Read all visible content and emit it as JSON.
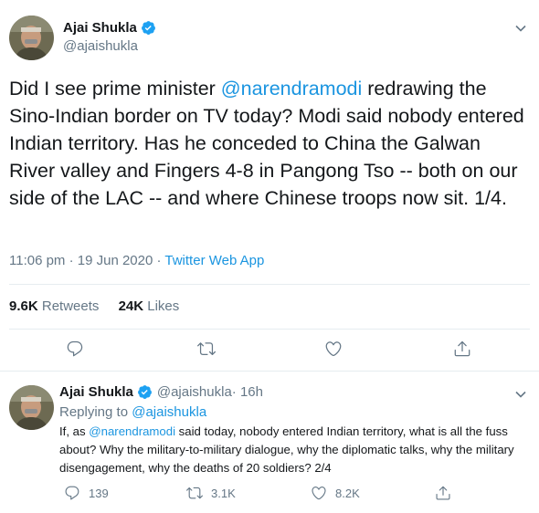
{
  "main_tweet": {
    "author_name": "Ajai Shukla",
    "author_handle": "@ajaishukla",
    "text_part1": "Did I see prime minister ",
    "mention": "@narendramodi",
    "text_part2": " redrawing the Sino-Indian border on TV today? Modi said nobody entered Indian territory. Has he conceded to China the Galwan River valley and Fingers 4-8 in Pangong Tso -- both on our side of the LAC -- and where Chinese troops now sit. 1/4.",
    "time": "11:06 pm · 19 Jun 2020 · ",
    "source": "Twitter Web App",
    "retweets_count": "9.6K",
    "retweets_label": " Retweets",
    "likes_count": "24K",
    "likes_label": " Likes",
    "actions": [
      "reply-icon",
      "retweet-icon",
      "like-icon",
      "share-icon"
    ]
  },
  "reply_tweet": {
    "author_name": "Ajai Shukla",
    "author_handle": "@ajaishukla",
    "time_ago": " · 16h",
    "replying_to_label": "Replying to ",
    "replying_to_handle": "@ajaishukla",
    "text_part1": "If, as ",
    "mention": "@narendramodi",
    "text_part2": " said today, nobody entered Indian territory, what is all the fuss about? Why the military-to-military dialogue, why the diplomatic talks, why the military disengagement, why the deaths of 20 soldiers? 2/4",
    "reply_count": "139",
    "retweet_count": "3.1K",
    "like_count": "8.2K"
  },
  "colors": {
    "accent": "#1b95e0",
    "text": "#14171a",
    "muted": "#657786",
    "border": "#e6ecf0"
  }
}
